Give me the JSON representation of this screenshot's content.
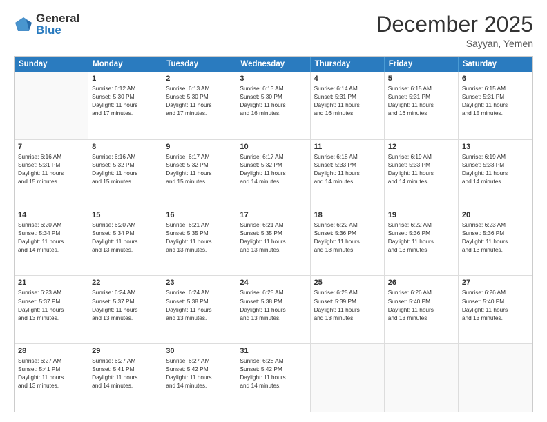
{
  "logo": {
    "general": "General",
    "blue": "Blue"
  },
  "title": "December 2025",
  "subtitle": "Sayyan, Yemen",
  "days": [
    "Sunday",
    "Monday",
    "Tuesday",
    "Wednesday",
    "Thursday",
    "Friday",
    "Saturday"
  ],
  "weeks": [
    [
      {
        "day": "",
        "info": ""
      },
      {
        "day": "1",
        "info": "Sunrise: 6:12 AM\nSunset: 5:30 PM\nDaylight: 11 hours\nand 17 minutes."
      },
      {
        "day": "2",
        "info": "Sunrise: 6:13 AM\nSunset: 5:30 PM\nDaylight: 11 hours\nand 17 minutes."
      },
      {
        "day": "3",
        "info": "Sunrise: 6:13 AM\nSunset: 5:30 PM\nDaylight: 11 hours\nand 16 minutes."
      },
      {
        "day": "4",
        "info": "Sunrise: 6:14 AM\nSunset: 5:31 PM\nDaylight: 11 hours\nand 16 minutes."
      },
      {
        "day": "5",
        "info": "Sunrise: 6:15 AM\nSunset: 5:31 PM\nDaylight: 11 hours\nand 16 minutes."
      },
      {
        "day": "6",
        "info": "Sunrise: 6:15 AM\nSunset: 5:31 PM\nDaylight: 11 hours\nand 15 minutes."
      }
    ],
    [
      {
        "day": "7",
        "info": "Sunrise: 6:16 AM\nSunset: 5:31 PM\nDaylight: 11 hours\nand 15 minutes."
      },
      {
        "day": "8",
        "info": "Sunrise: 6:16 AM\nSunset: 5:32 PM\nDaylight: 11 hours\nand 15 minutes."
      },
      {
        "day": "9",
        "info": "Sunrise: 6:17 AM\nSunset: 5:32 PM\nDaylight: 11 hours\nand 15 minutes."
      },
      {
        "day": "10",
        "info": "Sunrise: 6:17 AM\nSunset: 5:32 PM\nDaylight: 11 hours\nand 14 minutes."
      },
      {
        "day": "11",
        "info": "Sunrise: 6:18 AM\nSunset: 5:33 PM\nDaylight: 11 hours\nand 14 minutes."
      },
      {
        "day": "12",
        "info": "Sunrise: 6:19 AM\nSunset: 5:33 PM\nDaylight: 11 hours\nand 14 minutes."
      },
      {
        "day": "13",
        "info": "Sunrise: 6:19 AM\nSunset: 5:33 PM\nDaylight: 11 hours\nand 14 minutes."
      }
    ],
    [
      {
        "day": "14",
        "info": "Sunrise: 6:20 AM\nSunset: 5:34 PM\nDaylight: 11 hours\nand 14 minutes."
      },
      {
        "day": "15",
        "info": "Sunrise: 6:20 AM\nSunset: 5:34 PM\nDaylight: 11 hours\nand 13 minutes."
      },
      {
        "day": "16",
        "info": "Sunrise: 6:21 AM\nSunset: 5:35 PM\nDaylight: 11 hours\nand 13 minutes."
      },
      {
        "day": "17",
        "info": "Sunrise: 6:21 AM\nSunset: 5:35 PM\nDaylight: 11 hours\nand 13 minutes."
      },
      {
        "day": "18",
        "info": "Sunrise: 6:22 AM\nSunset: 5:36 PM\nDaylight: 11 hours\nand 13 minutes."
      },
      {
        "day": "19",
        "info": "Sunrise: 6:22 AM\nSunset: 5:36 PM\nDaylight: 11 hours\nand 13 minutes."
      },
      {
        "day": "20",
        "info": "Sunrise: 6:23 AM\nSunset: 5:36 PM\nDaylight: 11 hours\nand 13 minutes."
      }
    ],
    [
      {
        "day": "21",
        "info": "Sunrise: 6:23 AM\nSunset: 5:37 PM\nDaylight: 11 hours\nand 13 minutes."
      },
      {
        "day": "22",
        "info": "Sunrise: 6:24 AM\nSunset: 5:37 PM\nDaylight: 11 hours\nand 13 minutes."
      },
      {
        "day": "23",
        "info": "Sunrise: 6:24 AM\nSunset: 5:38 PM\nDaylight: 11 hours\nand 13 minutes."
      },
      {
        "day": "24",
        "info": "Sunrise: 6:25 AM\nSunset: 5:38 PM\nDaylight: 11 hours\nand 13 minutes."
      },
      {
        "day": "25",
        "info": "Sunrise: 6:25 AM\nSunset: 5:39 PM\nDaylight: 11 hours\nand 13 minutes."
      },
      {
        "day": "26",
        "info": "Sunrise: 6:26 AM\nSunset: 5:40 PM\nDaylight: 11 hours\nand 13 minutes."
      },
      {
        "day": "27",
        "info": "Sunrise: 6:26 AM\nSunset: 5:40 PM\nDaylight: 11 hours\nand 13 minutes."
      }
    ],
    [
      {
        "day": "28",
        "info": "Sunrise: 6:27 AM\nSunset: 5:41 PM\nDaylight: 11 hours\nand 13 minutes."
      },
      {
        "day": "29",
        "info": "Sunrise: 6:27 AM\nSunset: 5:41 PM\nDaylight: 11 hours\nand 14 minutes."
      },
      {
        "day": "30",
        "info": "Sunrise: 6:27 AM\nSunset: 5:42 PM\nDaylight: 11 hours\nand 14 minutes."
      },
      {
        "day": "31",
        "info": "Sunrise: 6:28 AM\nSunset: 5:42 PM\nDaylight: 11 hours\nand 14 minutes."
      },
      {
        "day": "",
        "info": ""
      },
      {
        "day": "",
        "info": ""
      },
      {
        "day": "",
        "info": ""
      }
    ]
  ]
}
